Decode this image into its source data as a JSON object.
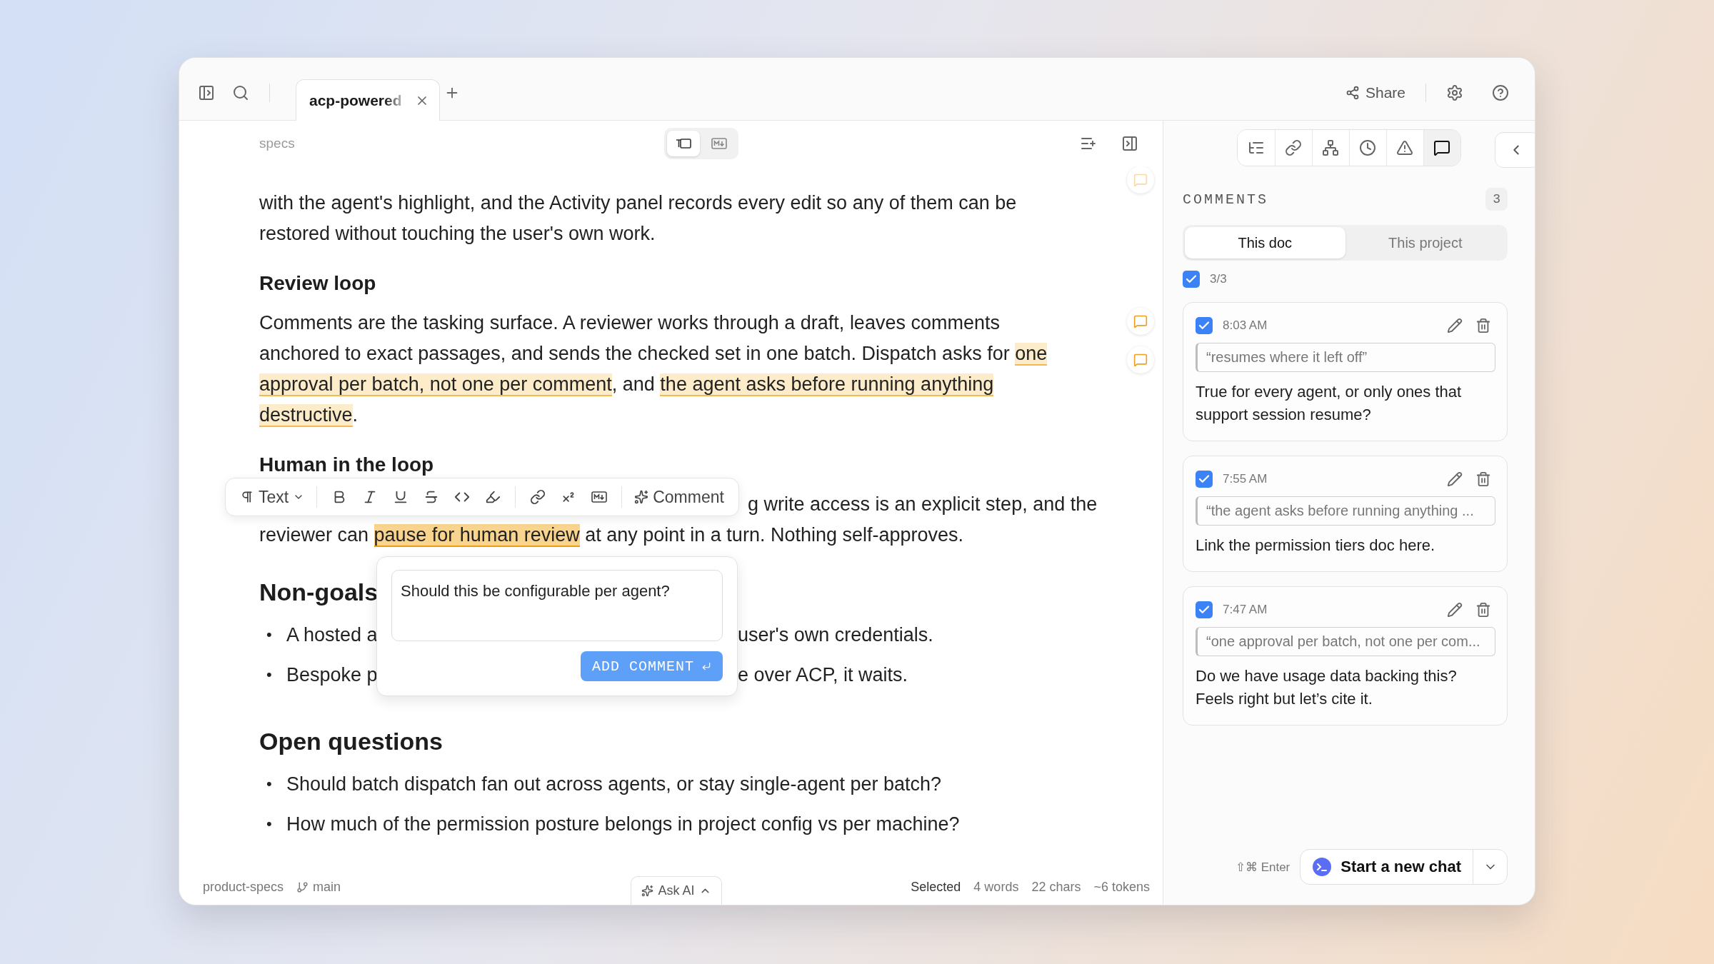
{
  "top_bar": {
    "tabs": [
      {
        "label": "acp-powered",
        "selected": true
      }
    ],
    "share": "Share"
  },
  "editor": {
    "breadcrumb": "specs",
    "view_modes": [
      {
        "selected": true
      },
      {
        "selected": false
      }
    ],
    "blocks": [
      {
        "kind": "paragraph",
        "segments": [
          {
            "text": "with the agent's highlight, and the Activity panel records every edit so any of them can be restored without touching the user's own work.",
            "highlighted": false,
            "selected": false
          }
        ]
      },
      {
        "kind": "subheading",
        "text": "Review loop"
      },
      {
        "kind": "paragraph",
        "segments": [
          {
            "text": "Comments are the tasking surface. A reviewer works through a draft, leaves comments anchored to exact passages, and sends the checked set in one batch. Dispatch asks for ",
            "highlighted": false,
            "selected": false
          },
          {
            "text": "one approval per batch, not one per comment",
            "highlighted": true,
            "selected": false
          },
          {
            "text": ", and ",
            "highlighted": false,
            "selected": false
          },
          {
            "text": "the agent asks before running anything destructive",
            "highlighted": true,
            "selected": false
          },
          {
            "text": ".",
            "highlighted": false,
            "selected": false
          }
        ]
      },
      {
        "kind": "subheading",
        "text": "Human in the loop"
      },
      {
        "kind": "covered",
        "lines": [
          {
            "covered_start": true,
            "segments": [
              {
                "text": "g write access is an explicit step, and the",
                "highlighted": false,
                "selected": false
              }
            ]
          },
          {
            "covered_start": false,
            "segments": [
              {
                "text": "reviewer can ",
                "highlighted": false,
                "selected": false
              },
              {
                "text": "pause for human review",
                "highlighted": true,
                "selected": true
              },
              {
                "text": " at any point in a turn. Nothing self-approves.",
                "highlighted": false,
                "selected": false
              }
            ]
          }
        ]
      },
      {
        "kind": "heading",
        "text": "Non-goals"
      },
      {
        "kind": "list",
        "items": [
          {
            "marker": "•",
            "parts": [
              "A hosted a",
              "user's own credentials."
            ]
          },
          {
            "marker": "•",
            "parts": [
              "Bespoke p",
              "e over ACP, it waits."
            ]
          }
        ]
      },
      {
        "kind": "heading",
        "text": "Open questions"
      },
      {
        "kind": "list",
        "items": [
          {
            "marker": "•",
            "parts": [
              "Should batch dispatch fan out across agents, or stay single-agent per batch?"
            ]
          },
          {
            "marker": "•",
            "parts": [
              "How much of the permission posture belongs in project config vs per machine?"
            ]
          }
        ]
      }
    ],
    "comment_markers": [
      {
        "faded": true
      },
      {
        "faded": false
      },
      {
        "faded": false
      }
    ]
  },
  "format_toolbar": {
    "block_type": "Text",
    "comment": "Comment"
  },
  "comment_popup": {
    "value": "Should this be configurable per agent?",
    "submit": "ADD COMMENT"
  },
  "status_bar": {
    "project": "product-specs",
    "branch": "main",
    "ask_ai": "Ask AI",
    "stats": [
      "Selected",
      "4 words",
      "22 chars",
      "~6 tokens"
    ]
  },
  "sidebar": {
    "tools": [
      {
        "selected": false
      },
      {
        "selected": false
      },
      {
        "selected": false
      },
      {
        "selected": false
      },
      {
        "selected": false
      },
      {
        "selected": true
      }
    ],
    "title": "COMMENTS",
    "count": "3",
    "scope_tabs": [
      {
        "label": "This doc",
        "selected": true
      },
      {
        "label": "This project",
        "selected": false
      }
    ],
    "select_all": {
      "checked": true,
      "label": "3/3"
    },
    "comments": [
      {
        "checked": true,
        "time": "8:03 AM",
        "quote": "“resumes where it left off”",
        "body": "True for every agent, or only ones that support session resume?"
      },
      {
        "checked": true,
        "time": "7:55 AM",
        "quote": "“the agent asks before running anything ...",
        "body": "Link the permission tiers doc here."
      },
      {
        "checked": true,
        "time": "7:47 AM",
        "quote": "“one approval per batch, not one per com...",
        "body": "Do we have usage data backing this? Feels right but let’s cite it."
      }
    ],
    "shortcut": "⇧⌘ Enter",
    "new_chat": "Start a new chat"
  }
}
